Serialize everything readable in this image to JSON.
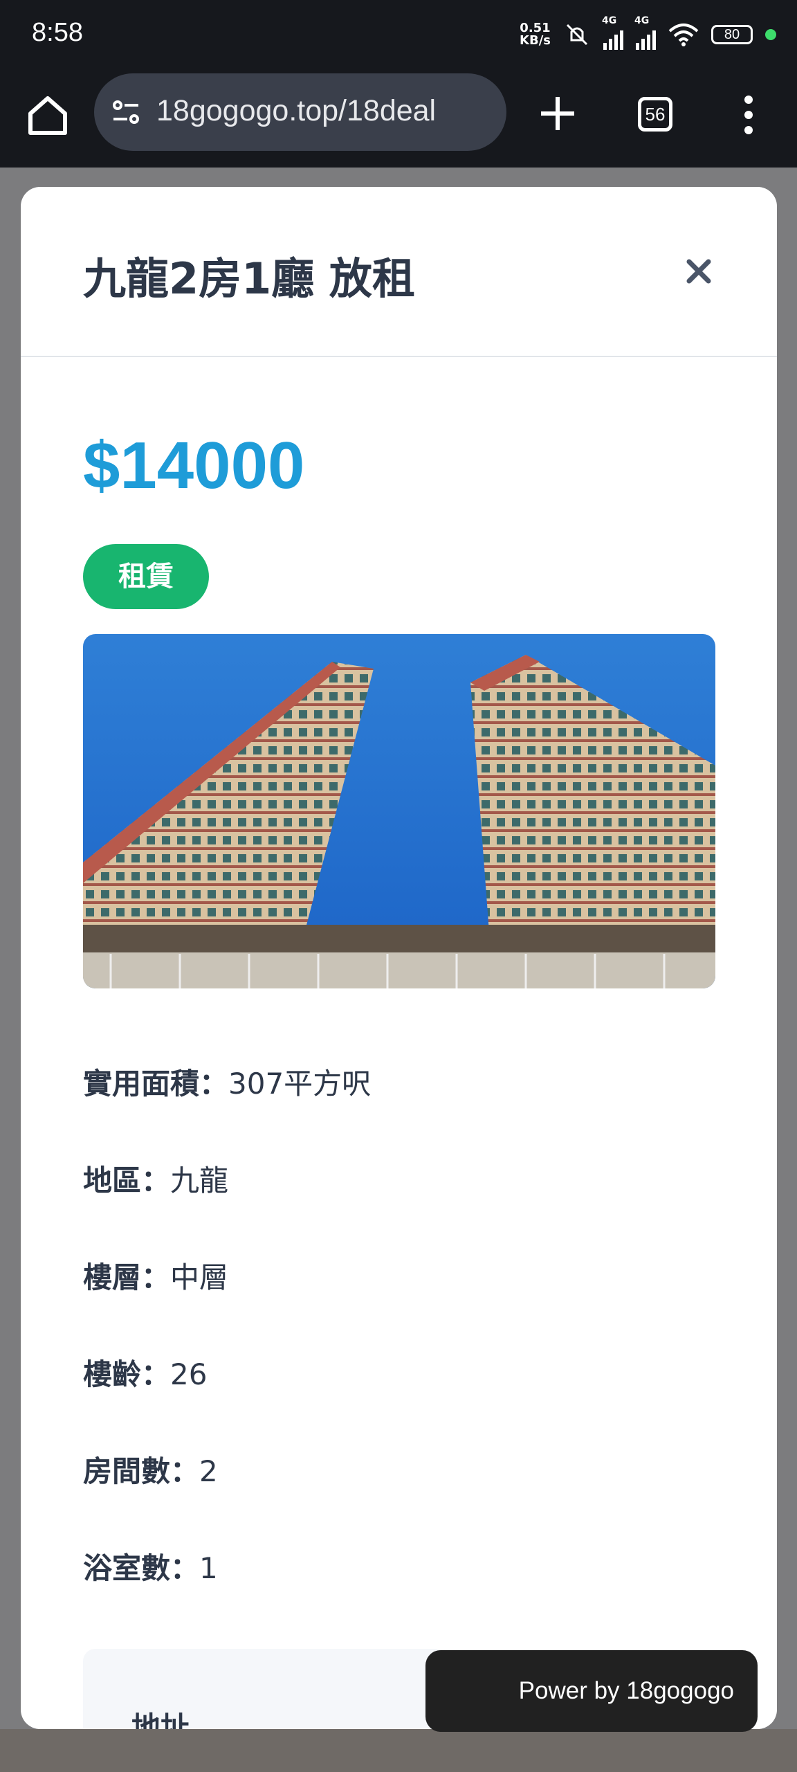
{
  "status_bar": {
    "time": "8:58",
    "net_speed_value": "0.51",
    "net_speed_unit": "KB/s",
    "signal1_label": "4G",
    "signal2_label": "4G",
    "battery": "80"
  },
  "browser": {
    "url": "18gogogo.top/18deal",
    "tab_count": "56"
  },
  "listing": {
    "title": "九龍2房1廳 放租",
    "price": "$14000",
    "type_badge": "租賃",
    "details": [
      {
        "label": "實用面積：",
        "value": "307平方呎"
      },
      {
        "label": "地區：",
        "value": "九龍"
      },
      {
        "label": "樓層：",
        "value": "中層"
      },
      {
        "label": "樓齡：",
        "value": "26"
      },
      {
        "label": "房間數：",
        "value": "2"
      },
      {
        "label": "浴室數：",
        "value": "1"
      }
    ],
    "address_label": "地址"
  },
  "footer": {
    "powered_by": "Power by 18gogogo"
  },
  "colors": {
    "price": "#1e9cd8",
    "badge": "#18b56f",
    "title": "#2d3748"
  },
  "icons": [
    "home-icon",
    "site-settings-icon",
    "plus-icon",
    "tabs-icon",
    "more-vert-icon",
    "close-icon",
    "mute-icon",
    "wifi-icon"
  ]
}
